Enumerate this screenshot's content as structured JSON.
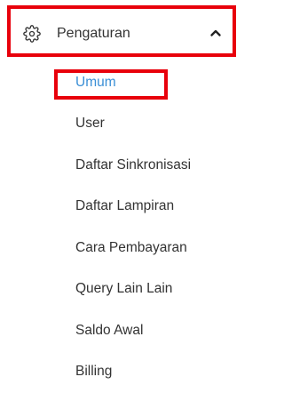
{
  "colors": {
    "highlight_border": "#e8000b",
    "active_text": "#3a8fd6",
    "text": "#333333"
  },
  "group": {
    "label": "Pengaturan",
    "icon": "gear-icon",
    "toggle_icon": "chevron-up-icon",
    "expanded": true
  },
  "items": [
    {
      "label": "Umum",
      "active": true
    },
    {
      "label": "User"
    },
    {
      "label": "Daftar Sinkronisasi"
    },
    {
      "label": "Daftar Lampiran"
    },
    {
      "label": "Cara Pembayaran"
    },
    {
      "label": "Query Lain Lain"
    },
    {
      "label": "Saldo Awal"
    },
    {
      "label": "Billing"
    }
  ]
}
